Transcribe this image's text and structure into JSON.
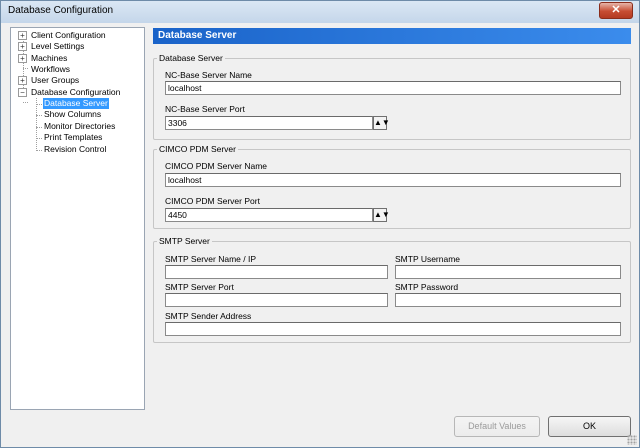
{
  "window": {
    "title": "Database Configuration",
    "close_label": "✕"
  },
  "tree": {
    "items": [
      {
        "label": "Client Configuration",
        "expander": "+"
      },
      {
        "label": "Level Settings",
        "expander": "+"
      },
      {
        "label": "Machines",
        "expander": "+"
      },
      {
        "label": "Workflows",
        "expander": ""
      },
      {
        "label": "User Groups",
        "expander": "+"
      },
      {
        "label": "Database Configuration",
        "expander": "−"
      },
      {
        "label": "Database Server",
        "expander": ""
      },
      {
        "label": "Show Columns",
        "expander": ""
      },
      {
        "label": "Monitor Directories",
        "expander": ""
      },
      {
        "label": "Print Templates",
        "expander": ""
      },
      {
        "label": "Revision Control",
        "expander": ""
      }
    ]
  },
  "panel": {
    "title": "Database Server"
  },
  "ncbase": {
    "group_title": "Database Server",
    "name_label": "NC-Base Server Name",
    "name_value": "localhost",
    "port_label": "NC-Base Server Port",
    "port_value": "3306"
  },
  "pdm": {
    "group_title": "CIMCO PDM Server",
    "name_label": "CIMCO PDM Server Name",
    "name_value": "localhost",
    "port_label": "CIMCO PDM Server Port",
    "port_value": "4450"
  },
  "smtp": {
    "group_title": "SMTP Server",
    "server_label": "SMTP Server Name / IP",
    "server_value": "",
    "username_label": "SMTP Username",
    "username_value": "",
    "port_label": "SMTP Server Port",
    "port_value": "",
    "password_label": "SMTP Password",
    "password_value": "",
    "sender_label": "SMTP Sender Address",
    "sender_value": ""
  },
  "buttons": {
    "default_values": "Default Values",
    "ok": "OK"
  },
  "icons": {
    "spin": "spin-updown-icon",
    "grip": "resize-grip-icon"
  }
}
